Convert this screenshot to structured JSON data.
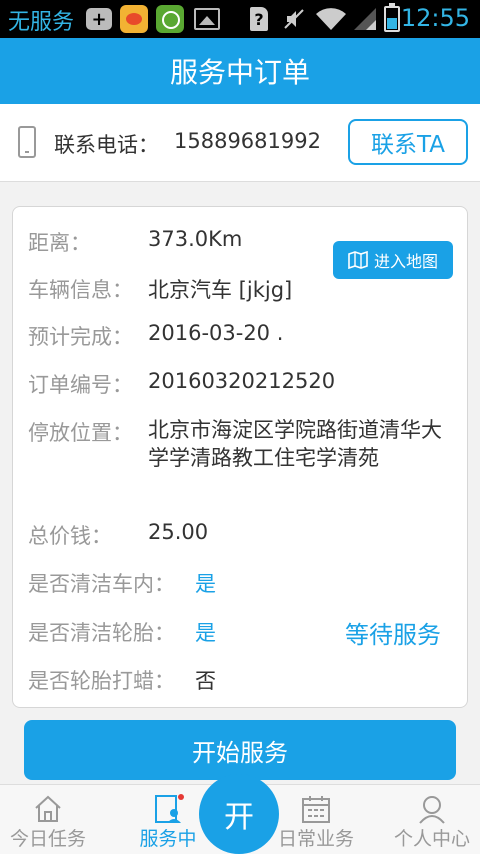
{
  "status_bar": {
    "carrier": "无服务",
    "sim_label": "?",
    "time": "12:55"
  },
  "header": {
    "title": "服务中订单"
  },
  "contact": {
    "label": "联系电话：",
    "phone": "15889681992",
    "button_label": "联系TA"
  },
  "order": {
    "map_button_label": "进入地图",
    "fields": [
      {
        "label": "距离：",
        "value": "373.0Km"
      },
      {
        "label": "车辆信息：",
        "value": "北京汽车 [jkjg]"
      },
      {
        "label": "预计完成：",
        "value": "2016-03-20 ."
      },
      {
        "label": "订单编号：",
        "value": "20160320212520"
      },
      {
        "label": "停放位置：",
        "value": "北京市海淀区学院路街道清华大学学清路教工住宅学清苑"
      },
      {
        "label": "总价钱：",
        "value": "25.00"
      },
      {
        "label": "是否清洁车内：",
        "value": "是"
      },
      {
        "label": "是否清洁轮胎：",
        "value": "是"
      },
      {
        "label": "是否轮胎打蜡：",
        "value": "否"
      }
    ],
    "status": "等待服务"
  },
  "start_button_label": "开始服务",
  "tabbar": {
    "tabs": [
      {
        "label": "今日任务",
        "icon": "home-icon"
      },
      {
        "label": "服务中",
        "icon": "in-service-icon"
      },
      {
        "label": "日常业务",
        "icon": "calendar-icon"
      },
      {
        "label": "个人中心",
        "icon": "person-icon"
      }
    ],
    "center_label": "开",
    "active_color": "#1aa1e6",
    "inactive_color": "#999999"
  },
  "colors": {
    "primary": "#1aa1e6"
  }
}
